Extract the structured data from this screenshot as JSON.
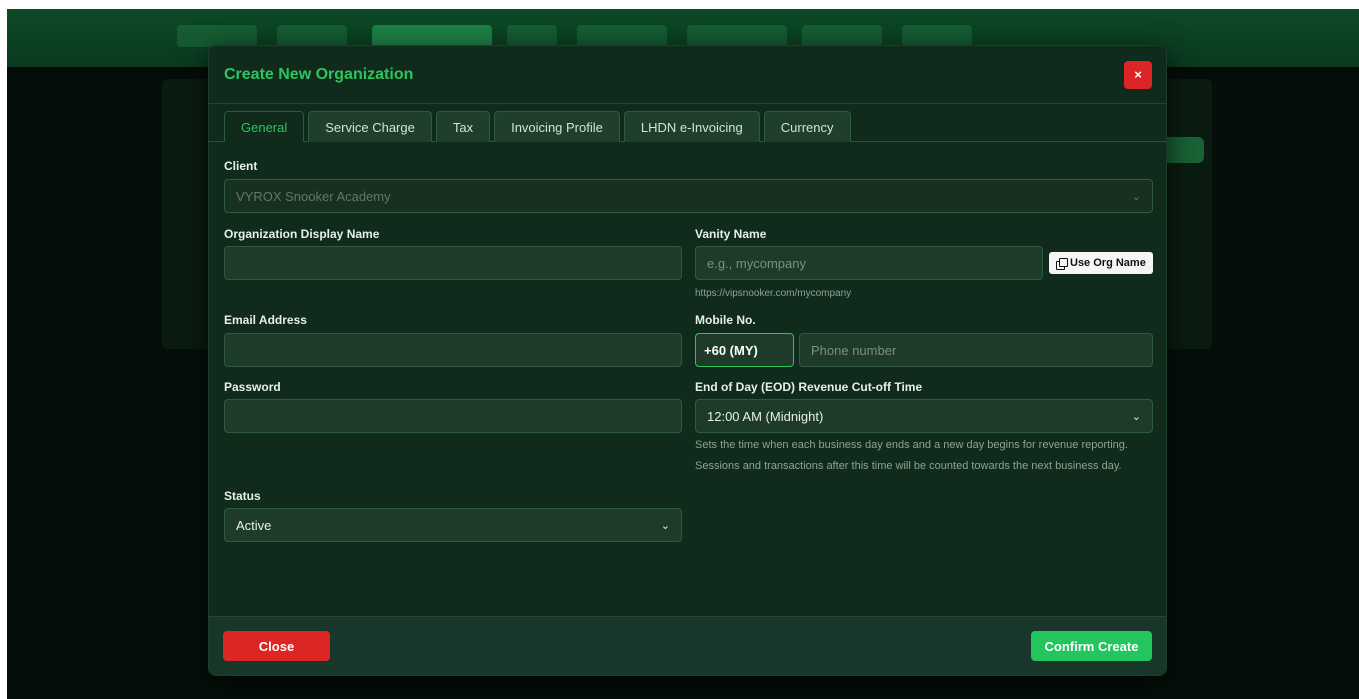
{
  "modal": {
    "title": "Create New Organization",
    "close_x_label": "×"
  },
  "tabs": [
    {
      "label": "General",
      "active": true
    },
    {
      "label": "Service Charge"
    },
    {
      "label": "Tax"
    },
    {
      "label": "Invoicing Profile"
    },
    {
      "label": "LHDN e-Invoicing"
    },
    {
      "label": "Currency"
    }
  ],
  "form": {
    "client": {
      "label": "Client",
      "value": "VYROX Snooker Academy"
    },
    "org_display_name": {
      "label": "Organization Display Name",
      "value": "",
      "placeholder": ""
    },
    "vanity_name": {
      "label": "Vanity Name",
      "placeholder": "e.g., mycompany",
      "use_org_button": "Use Org Name",
      "help": "https://vipsnooker.com/mycompany"
    },
    "email": {
      "label": "Email Address",
      "value": ""
    },
    "mobile": {
      "label": "Mobile No.",
      "country_code": "+60 (MY)",
      "placeholder": "Phone number"
    },
    "password": {
      "label": "Password",
      "value": ""
    },
    "eod": {
      "label": "End of Day (EOD) Revenue Cut-off Time",
      "value": "12:00 AM (Midnight)",
      "help_line1": "Sets the time when each business day ends and a new day begins for revenue reporting.",
      "help_line2": "Sessions and transactions after this time will be counted towards the next business day."
    },
    "status": {
      "label": "Status",
      "value": "Active"
    }
  },
  "footer": {
    "close_label": "Close",
    "confirm_label": "Confirm Create"
  },
  "colors": {
    "accent": "#22c55e",
    "danger": "#dc2626",
    "modal_bg": "#102a1b"
  }
}
